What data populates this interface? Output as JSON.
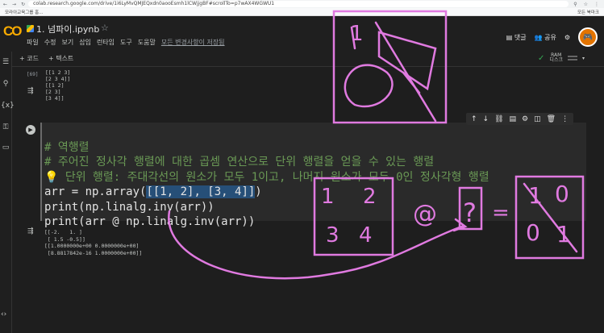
{
  "browser": {
    "url": "colab.research.google.com/drive/1i6LyMvQMJEQxdn0aooEsmh1lCWjjgBF#scrollTo=p7wAX4WGWU1",
    "bookmark_left": "모라아교육그룹 홈...",
    "bookmark_right": "모든 북마크"
  },
  "header": {
    "logo": "CO",
    "filename": "1. 넘파이.ipynb",
    "star": "☆",
    "menus": [
      "파일",
      "수정",
      "보기",
      "삽입",
      "런타임",
      "도구",
      "도움말"
    ],
    "save_status": "모든 변경사항이 저장됨",
    "comments_label": "댓글",
    "share_label": "공유"
  },
  "toolbar": {
    "add_code": "+ 코드",
    "add_text": "+ 텍스트",
    "ram_label": "RAM",
    "disk_label": "디스크"
  },
  "output1": {
    "exec_count": "[69]",
    "lines_a": [
      "[[1 2 3]",
      " [2 3 4]]"
    ],
    "lines_b": [
      "[[1 2]",
      " [2 3]",
      " [3 4]]"
    ]
  },
  "cell": {
    "line1": "# 역행렬",
    "line2": "# 주어진 정사각 행렬에 대한 곱셈 연산으로 단위 행렬을 얻을 수 있는 행렬",
    "line3": "💡 단위 행렬: 주대각선의 원소가 모두 1이고, 나머지 원소가 모두 0인 정사각형 행렬",
    "line4_pre": "arr = np.array(",
    "line4_hl": "[[1, 2], [3, 4]]",
    "line4_post": ")",
    "line5": "print(np.linalg.inv(arr))",
    "line6": "print(arr @ np.linalg.inv(arr))"
  },
  "output2": {
    "lines": [
      "[[-2.   1. ]",
      " [ 1.5 -0.5]]",
      "[[1.0000000e+00 0.0000000e+00]",
      " [8.8817842e-16 1.0000000e+00]]"
    ]
  },
  "annotations": {
    "box1_tl": "1",
    "box1_tr": "2",
    "box1_bl": "3",
    "box1_br": "4",
    "at_sign": "@",
    "question": "?",
    "equals": "=",
    "result_tl": "1",
    "result_tr": "0",
    "result_bl": "0",
    "result_br": "1",
    "top_digit": "1"
  },
  "colors": {
    "annotation": "#e07ae0",
    "comment": "#6a9955",
    "highlight": "#264f78"
  }
}
